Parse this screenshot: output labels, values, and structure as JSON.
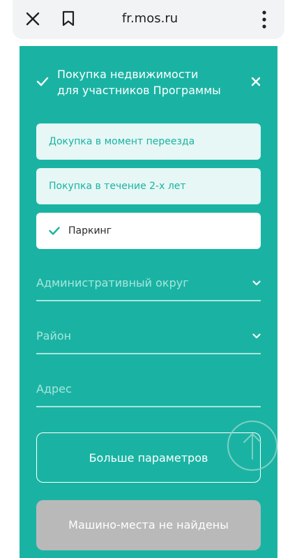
{
  "browser": {
    "url": "fr.mos.ru",
    "icons": {
      "close": "close-icon",
      "bookmark": "bookmark-icon",
      "menu": "more-vertical-icon"
    }
  },
  "filters": {
    "program_title_line1": "Покупка недвижимости",
    "program_title_line2": "для участников Программы",
    "options": [
      {
        "label": "Докупка в момент переезда",
        "selected": false
      },
      {
        "label": "Покупка в течение 2-х лет",
        "selected": false
      },
      {
        "label": "Паркинг",
        "selected": true
      }
    ],
    "district_placeholder": "Административный округ",
    "area_placeholder": "Район",
    "address_placeholder": "Адрес",
    "more_params_label": "Больше параметров",
    "result_label": "Машино-места не найдены"
  },
  "colors": {
    "panel": "#1ab3a3",
    "option_light": "#e6f7f5",
    "field_line": "#a8e6de",
    "disabled_button": "#b9b9b9"
  }
}
